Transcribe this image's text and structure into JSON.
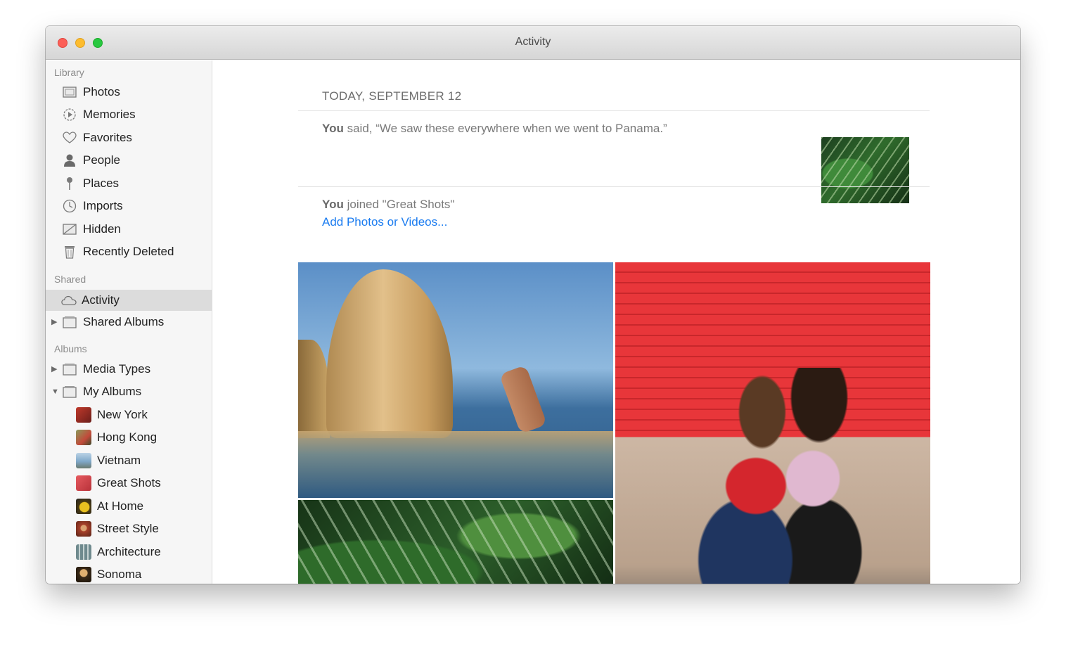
{
  "window": {
    "title": "Activity"
  },
  "sidebar": {
    "library_header": "Library",
    "library_items": [
      {
        "label": "Photos",
        "icon": "photos-icon"
      },
      {
        "label": "Memories",
        "icon": "memories-icon"
      },
      {
        "label": "Favorites",
        "icon": "heart-icon"
      },
      {
        "label": "People",
        "icon": "person-icon"
      },
      {
        "label": "Places",
        "icon": "pin-icon"
      },
      {
        "label": "Imports",
        "icon": "clock-icon"
      },
      {
        "label": "Hidden",
        "icon": "hidden-icon"
      },
      {
        "label": "Recently Deleted",
        "icon": "trash-icon"
      }
    ],
    "shared_header": "Shared",
    "shared_items": [
      {
        "label": "Activity",
        "icon": "cloud-icon",
        "selected": true
      },
      {
        "label": "Shared Albums",
        "icon": "album-icon",
        "disclosure": "collapsed"
      }
    ],
    "albums_header": "Albums",
    "album_groups": [
      {
        "label": "Media Types",
        "icon": "album-icon",
        "disclosure": "collapsed"
      },
      {
        "label": "My Albums",
        "icon": "album-icon",
        "disclosure": "expanded"
      }
    ],
    "my_albums": [
      {
        "label": "New York",
        "color": "#c0392b"
      },
      {
        "label": "Hong Kong",
        "color": "#6a7a4a"
      },
      {
        "label": "Vietnam",
        "color": "#7fa8c9"
      },
      {
        "label": "Great Shots",
        "color": "#d94a4f"
      },
      {
        "label": "At Home",
        "color": "#d8b020"
      },
      {
        "label": "Street Style",
        "color": "#a8402a"
      },
      {
        "label": "Architecture",
        "color": "#6f8a8e"
      },
      {
        "label": "Sonoma",
        "color": "#c98a40"
      }
    ]
  },
  "activity": {
    "date_header": "TODAY, SEPTEMBER 12",
    "comment": {
      "author": "You",
      "text": " said, “We saw these everywhere when we went to Panama.”"
    },
    "join": {
      "author": "You",
      "text": " joined \"Great Shots\""
    },
    "add_link": "Add Photos or Videos..."
  }
}
